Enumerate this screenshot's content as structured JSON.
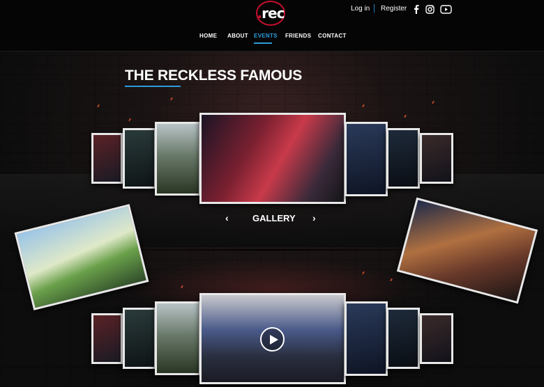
{
  "header": {
    "logo_text": "rec",
    "login_label": "Log in",
    "register_label": "Register",
    "social_icons": [
      "facebook-icon",
      "instagram-icon",
      "youtube-icon"
    ]
  },
  "nav": {
    "items": [
      {
        "label": "HOME"
      },
      {
        "label": "ABOUT"
      },
      {
        "label": "EVENTS",
        "active": true
      },
      {
        "label": "FRIENDS"
      },
      {
        "label": "CONTACT"
      }
    ]
  },
  "main": {
    "title": "THE RECKLESS FAMOUS",
    "gallery_label": "GALLERY",
    "prev_icon": "chevron-left-icon",
    "next_icon": "chevron-right-icon",
    "video_icon": "play-icon"
  },
  "colors": {
    "accent_blue": "#2d9cdb",
    "logo_red": "#c8102e",
    "background": "#0a0a0a"
  }
}
